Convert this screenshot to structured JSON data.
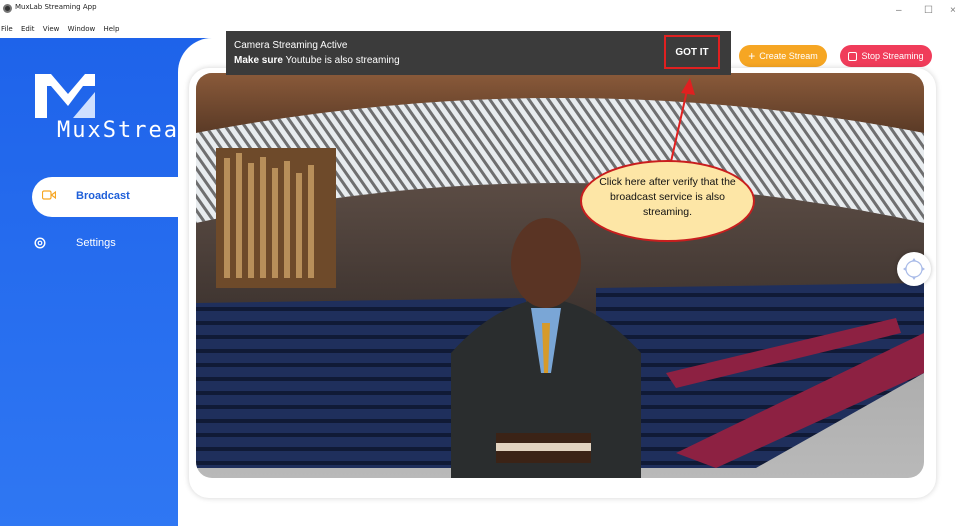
{
  "window": {
    "title": "MuxLab Streaming App",
    "controls": {
      "minimize": "–",
      "maximize": "☐",
      "close": "×"
    }
  },
  "menu": [
    "File",
    "Edit",
    "View",
    "Window",
    "Help"
  ],
  "sidebar": {
    "logo_text": "MuxStream",
    "items": [
      {
        "label": "Broadcast",
        "icon": "camera-icon",
        "active": true
      },
      {
        "label": "Settings",
        "icon": "gear-icon",
        "active": false
      }
    ]
  },
  "notification": {
    "line1": "Camera Streaming Active",
    "line2_bold": "Make sure",
    "line2_rest": " Youtube is also streaming",
    "action_label": "GOT IT"
  },
  "toolbar": {
    "create_label": "Create Stream",
    "create_icon": "+",
    "stop_label": "Stop Streaming"
  },
  "callout": {
    "text": "Click here after verify that the broadcast service is also streaming."
  },
  "colors": {
    "sidebar": "#2569ee",
    "create_button": "#f6a623",
    "stop_button": "#f03c5a",
    "callout_fill": "#fde6a6",
    "callout_border": "#c81e1e",
    "notification_bg": "#3b3b3b"
  }
}
